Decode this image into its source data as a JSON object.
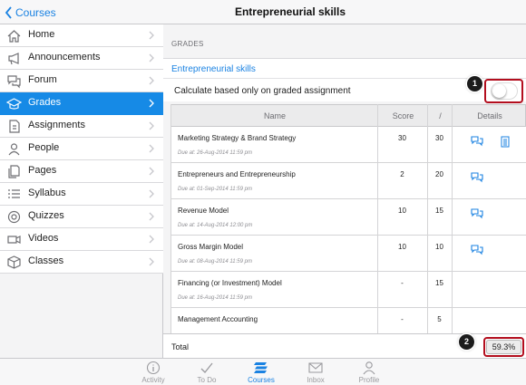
{
  "nav": {
    "back_label": "Courses",
    "title": "Entrepreneurial skills"
  },
  "sidebar": {
    "items": [
      {
        "label": "Home",
        "icon": "home-icon"
      },
      {
        "label": "Announcements",
        "icon": "megaphone-icon"
      },
      {
        "label": "Forum",
        "icon": "chat-bubbles-icon"
      },
      {
        "label": "Grades",
        "icon": "grades-icon",
        "active": true
      },
      {
        "label": "Assignments",
        "icon": "assignment-icon"
      },
      {
        "label": "People",
        "icon": "people-icon"
      },
      {
        "label": "Pages",
        "icon": "pages-icon"
      },
      {
        "label": "Syllabus",
        "icon": "syllabus-icon"
      },
      {
        "label": "Quizzes",
        "icon": "quiz-icon"
      },
      {
        "label": "Videos",
        "icon": "video-camera-icon"
      },
      {
        "label": "Classes",
        "icon": "classes-icon"
      }
    ]
  },
  "main": {
    "section_header": "GRADES",
    "course_link": "Entrepreneurial skills",
    "calc_label": "Calculate based only on graded assignment",
    "toggle_on": false,
    "callouts": [
      "1",
      "2"
    ],
    "table": {
      "headers": {
        "name": "Name",
        "score": "Score",
        "out_of": "/",
        "details": "Details"
      },
      "rows": [
        {
          "name": "Marketing Strategy & Brand Strategy",
          "due": "Due at: 26-Aug-2014 11:59 pm",
          "score": "30",
          "out_of": "30",
          "icons": [
            "comment-icon",
            "document-icon"
          ]
        },
        {
          "name": "Entrepreneurs and Entrepreneurship",
          "due": "Due at: 01-Sep-2014 11:59 pm",
          "score": "2",
          "out_of": "20",
          "icons": [
            "comment-icon"
          ]
        },
        {
          "name": "Revenue Model",
          "due": "Due at: 14-Aug-2014 12:00 pm",
          "score": "10",
          "out_of": "15",
          "icons": [
            "comment-icon"
          ]
        },
        {
          "name": "Gross Margin Model",
          "due": "Due at: 08-Aug-2014 11:59 pm",
          "score": "10",
          "out_of": "10",
          "icons": [
            "comment-icon"
          ]
        },
        {
          "name": "Financing (or Investment) Model",
          "due": "Due at: 16-Aug-2014 11:59 pm",
          "score": "-",
          "out_of": "15",
          "icons": []
        },
        {
          "name": "Management Accounting",
          "due": "",
          "score": "-",
          "out_of": "5",
          "icons": []
        }
      ]
    },
    "total_label": "Total",
    "total_value": "59.3%"
  },
  "tabbar": {
    "items": [
      {
        "label": "Activity",
        "icon": "info-icon"
      },
      {
        "label": "To Do",
        "icon": "checkmark-icon"
      },
      {
        "label": "Courses",
        "icon": "courses-icon",
        "active": true
      },
      {
        "label": "Inbox",
        "icon": "inbox-icon"
      },
      {
        "label": "Profile",
        "icon": "profile-icon"
      }
    ]
  },
  "colors": {
    "accent": "#1a82e2",
    "active_row": "#168ae6",
    "highlight": "#b30e1e"
  }
}
